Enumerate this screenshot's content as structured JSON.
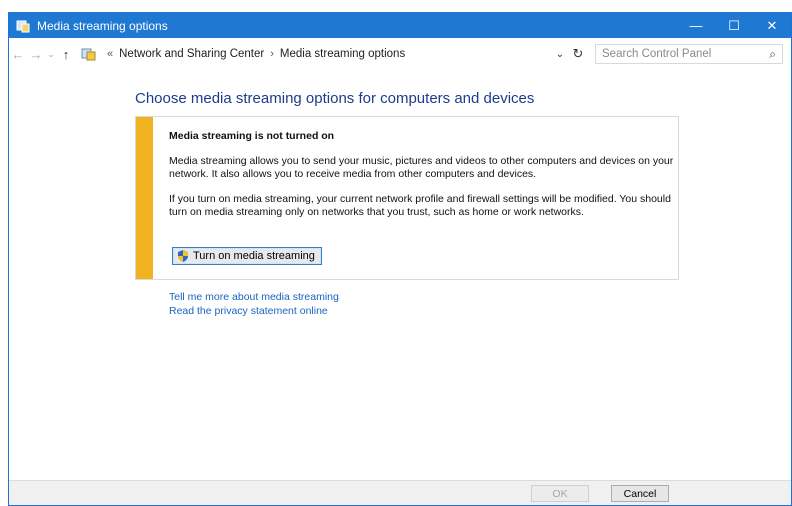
{
  "window": {
    "title": "Media streaming options",
    "controls": {
      "minimize": "—",
      "maximize": "☐",
      "close": "✕"
    }
  },
  "addressbar": {
    "back": "←",
    "forward": "→",
    "recent": "⌄",
    "up": "↑",
    "overflow": "«",
    "breadcrumbs": [
      "Network and Sharing Center",
      "Media streaming options"
    ],
    "separator": "›",
    "dropdown": "⌄",
    "refresh": "↻",
    "search_placeholder": "Search Control Panel",
    "search_icon": "⌕"
  },
  "main": {
    "heading": "Choose media streaming options for computers and devices",
    "notice": {
      "title": "Media streaming is not turned on",
      "paragraph1": "Media streaming allows you to send your music, pictures and videos to other computers and devices on your network.  It also allows you to receive media from other computers and devices.",
      "paragraph2": "If you turn on media streaming, your current network profile and firewall settings will be modified. You should turn on media streaming only on networks that you trust, such as home or work networks.",
      "button_label": "Turn on media streaming",
      "accent_color": "#f2b323"
    },
    "links": [
      "Tell me more about media streaming",
      "Read the privacy statement online"
    ]
  },
  "footer": {
    "ok_label": "OK",
    "cancel_label": "Cancel"
  },
  "colors": {
    "titlebar": "#1f78d1",
    "heading": "#1e3c8c",
    "link": "#1a64c0"
  }
}
